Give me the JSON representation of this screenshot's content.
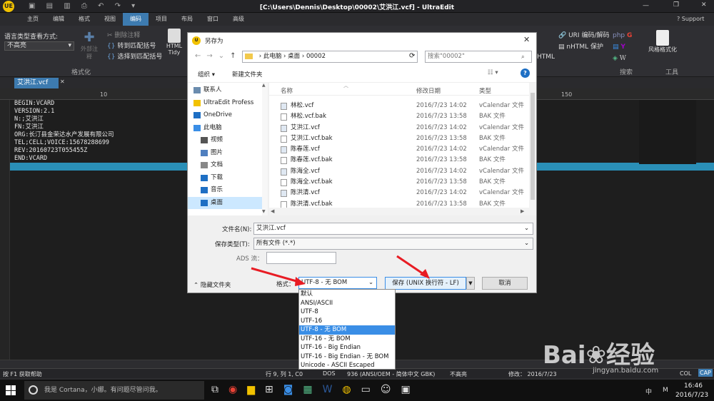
{
  "window": {
    "title": "[C:\\Users\\Dennis\\Desktop\\00002\\艾洪江.vcf] - UltraEdit",
    "support": "Support"
  },
  "menu": [
    "主页",
    "编辑",
    "格式",
    "视图",
    "编码",
    "项目",
    "布局",
    "窗口",
    "高级"
  ],
  "menu_active_index": 4,
  "ribbon": {
    "lang_label": "语言类型查看方式:",
    "lang_value": "不高亮",
    "del_comment": "删除注释",
    "outer_comment": "外部注释",
    "goto_match": "转到匹配括号",
    "select_match": "选择到匹配括号",
    "format_group": "格式化",
    "html_tidy": "HTML Tidy",
    "url_codec": "URI 编码/解码",
    "nhtml": "nHTML 保护",
    "html": "HTML",
    "search_group": "搜索",
    "style_fmt": "风格格式化",
    "tools_group": "工具"
  },
  "doc_tab": "艾洪江.vcf",
  "code_lines": [
    "BEGIN:VCARD",
    "VERSION:2.1",
    "N:;艾洪江",
    "FN:艾洪江",
    "ORG:长汀县金荣达水产发展有限公司",
    "TEL;CELL;VOICE:15678288699",
    "REV:20160723T055455Z",
    "END:VCARD"
  ],
  "ruler_labels": [
    "10",
    "150"
  ],
  "dialog": {
    "title": "另存为",
    "breadcrumb": [
      "此电脑",
      "桌面",
      "00002"
    ],
    "search_placeholder": "搜索\"00002\"",
    "organize": "组织 ▾",
    "new_folder": "新建文件夹",
    "nav": [
      {
        "label": "联系人",
        "icon": "contacts-icon"
      },
      {
        "label": "UltraEdit Profess",
        "icon": "ultraedit-icon"
      },
      {
        "label": "OneDrive",
        "icon": "onedrive-icon"
      },
      {
        "label": "此电脑",
        "icon": "computer-icon"
      },
      {
        "label": "视频",
        "icon": "video-icon"
      },
      {
        "label": "图片",
        "icon": "picture-icon"
      },
      {
        "label": "文档",
        "icon": "document-icon"
      },
      {
        "label": "下载",
        "icon": "download-icon"
      },
      {
        "label": "音乐",
        "icon": "music-icon"
      },
      {
        "label": "桌面",
        "icon": "desktop-icon"
      }
    ],
    "columns": [
      "名称",
      "修改日期",
      "类型"
    ],
    "files": [
      {
        "name": "林松.vcf",
        "date": "2016/7/23 14:02",
        "type": "vCalendar 文件"
      },
      {
        "name": "林松.vcf.bak",
        "date": "2016/7/23 13:58",
        "type": "BAK 文件"
      },
      {
        "name": "艾洪江.vcf",
        "date": "2016/7/23 14:02",
        "type": "vCalendar 文件"
      },
      {
        "name": "艾洪江.vcf.bak",
        "date": "2016/7/23 13:58",
        "type": "BAK 文件"
      },
      {
        "name": "陈春莲.vcf",
        "date": "2016/7/23 14:02",
        "type": "vCalendar 文件"
      },
      {
        "name": "陈春莲.vcf.bak",
        "date": "2016/7/23 13:58",
        "type": "BAK 文件"
      },
      {
        "name": "陈海全.vcf",
        "date": "2016/7/23 14:02",
        "type": "vCalendar 文件"
      },
      {
        "name": "陈海全.vcf.bak",
        "date": "2016/7/23 13:58",
        "type": "BAK 文件"
      },
      {
        "name": "陈洪清.vcf",
        "date": "2016/7/23 14:02",
        "type": "vCalendar 文件"
      },
      {
        "name": "陈洪清.vcf.bak",
        "date": "2016/7/23 13:58",
        "type": "BAK 文件"
      }
    ],
    "filename_label": "文件名(N):",
    "filename_value": "艾洪江.vcf",
    "filetype_label": "保存类型(T):",
    "filetype_value": "所有文件 (*.*)",
    "ads_label": "ADS 流：",
    "hide_folders": "隐藏文件夹",
    "format_label": "格式：",
    "format_value": "UTF-8 - 无 BOM",
    "save_button": "保存 (UNIX 换行符 - LF)",
    "cancel_button": "取消"
  },
  "format_options": [
    "默认",
    "ANSI/ASCII",
    "UTF-8",
    "UTF-16",
    "UTF-8 - 无 BOM",
    "UTF-16 - 无 BOM",
    "UTF-16 - Big Endian",
    "UTF-16 - Big Endian  - 无 BOM",
    "Unicode - ASCII Escaped"
  ],
  "format_selected_index": 4,
  "status": {
    "help": "按 F1 获取帮助",
    "pos": "行 9, 列 1, C0",
    "eol": "DOS",
    "encoding": "936  (ANSI/OEM - 简体中文 GBK)",
    "highlight": "不高亮",
    "modified": "修改：  2016/7/23",
    "col": "COL",
    "cap": "CAP"
  },
  "taskbar": {
    "cortana": "我是 Cortana，小娜。有问题尽管问我。",
    "time": "16:46",
    "date": "2016/7/23",
    "ime": "中",
    "ime2": "M"
  },
  "watermark": "Baidu经验 jingyan.baidu.com",
  "colors": {
    "accent": "#3d7bb0",
    "selection": "#3a8ee6",
    "arrow": "#e81c24"
  }
}
